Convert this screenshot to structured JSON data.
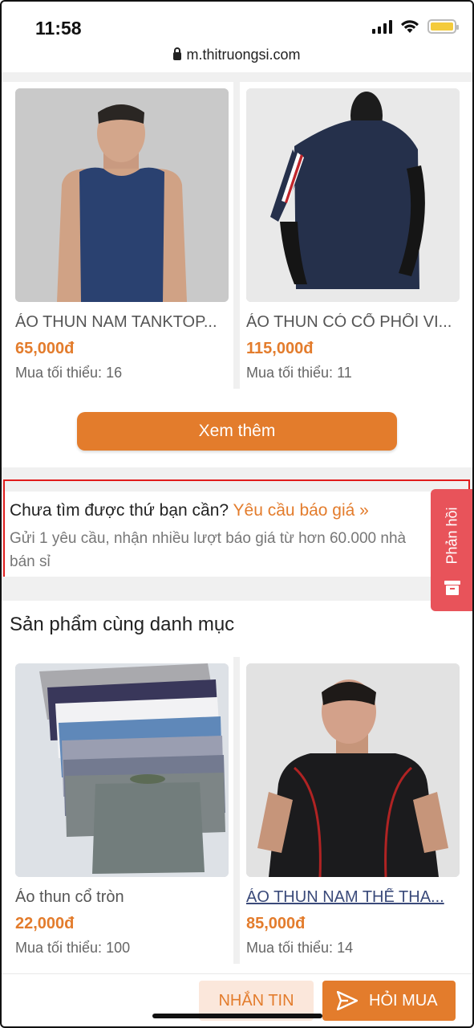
{
  "status_bar": {
    "time": "11:58"
  },
  "browser": {
    "url": "m.thitruongsi.com"
  },
  "products_top": [
    {
      "name": "ÁO THUN NAM TANKTOP...",
      "price": "65,000đ",
      "min_qty": "Mua tối thiểu: 16"
    },
    {
      "name": "ÁO THUN CÓ CỔ PHỐI VI...",
      "price": "115,000đ",
      "min_qty": "Mua tối thiểu: 11"
    }
  ],
  "more_button": "Xem thêm",
  "quote": {
    "question": "Chưa tìm được thứ bạn cần?",
    "link": "Yêu cầu báo giá »",
    "description": "Gửi 1 yêu cầu, nhận nhiều lượt báo giá từ hơn 60.000 nhà bán sỉ"
  },
  "feedback_tab": "Phản hồi",
  "related_section": {
    "title": "Sản phẩm cùng danh mục"
  },
  "products_related": [
    {
      "name": "Áo thun cổ tròn",
      "price": "22,000đ",
      "min_qty": "Mua tối thiểu: 100"
    },
    {
      "name": "ÁO THUN NAM THỂ THA...",
      "price": "85,000đ",
      "min_qty": "Mua tối thiểu: 14"
    }
  ],
  "bottom_bar": {
    "message_label": "NHẮN TIN",
    "buy_label": "HỎI MUA"
  },
  "colors": {
    "accent": "#e37c2c",
    "feedback": "#e8535a",
    "highlight_box": "#e11d1d"
  }
}
